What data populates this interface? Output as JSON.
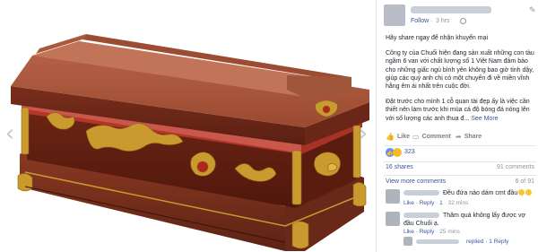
{
  "post": {
    "follow_label": "Follow",
    "separator": "·",
    "time": "3 hrs",
    "paragraphs": [
      "Hãy share ngay để nhận khuyến mại",
      "Công ty của Chuối hiện đang sản xuất những con tàu ngầm 6 van với chất lượng số 1 Việt Nam đảm bảo cho những giấc ngủ bình yên không bao giờ tỉnh dậy, giúp các quý anh chị có một chuyến đi về miền vĩnh hằng êm ái nhất trên cuộc đời.",
      "Đặt trước cho mình 1 cỗ quan tài đẹp ấy là việc cần thiết nên làm trước khi mùa cá độ bóng đá nóng lên với số lượng các anh thua đ..."
    ],
    "see_more": "See More"
  },
  "actions": {
    "like": "Like",
    "comment": "Comment",
    "share": "Share"
  },
  "reactions": {
    "count": "323"
  },
  "stats": {
    "shares": "16 shares",
    "comments": "91 comments"
  },
  "comments_section": {
    "view_more": "View more comments",
    "counter": "6 of 91",
    "items": [
      {
        "text": "Đều đứa nào dám cmt đầu",
        "like": "Like",
        "reply": "Reply",
        "likes": "1",
        "time": "32 mins"
      },
      {
        "text_line1": "Thăm quá không lấy được vợ",
        "text_line2": "đầu Chuối ạ.",
        "like": "Like",
        "reply": "Reply",
        "time": "25 mins"
      }
    ],
    "replies_label": "replied · 1 Reply"
  },
  "colors": {
    "link": "#365899",
    "meta": "#90949c",
    "wood": "#8e3a22",
    "gold": "#c99a2e"
  }
}
